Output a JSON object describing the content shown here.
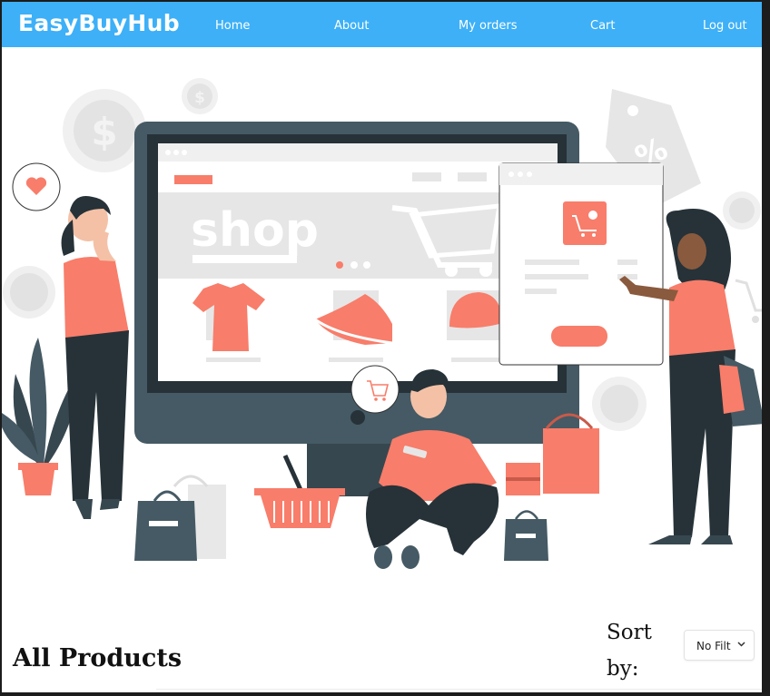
{
  "navbar": {
    "brand": "EasyBuyHub",
    "links": [
      "Home",
      "About",
      "My orders",
      "Cart",
      "Log out"
    ]
  },
  "hero": {
    "illustration": "online-shopping-illustration",
    "screen_word": "shop"
  },
  "products": {
    "title": "All Products",
    "sort_label": "Sort by:",
    "sort_value": "No Filt"
  },
  "colors": {
    "navbar": "#3db0f7",
    "accent": "#f87d6a",
    "dark": "#34474e",
    "light_gray": "#e6e6e6"
  }
}
